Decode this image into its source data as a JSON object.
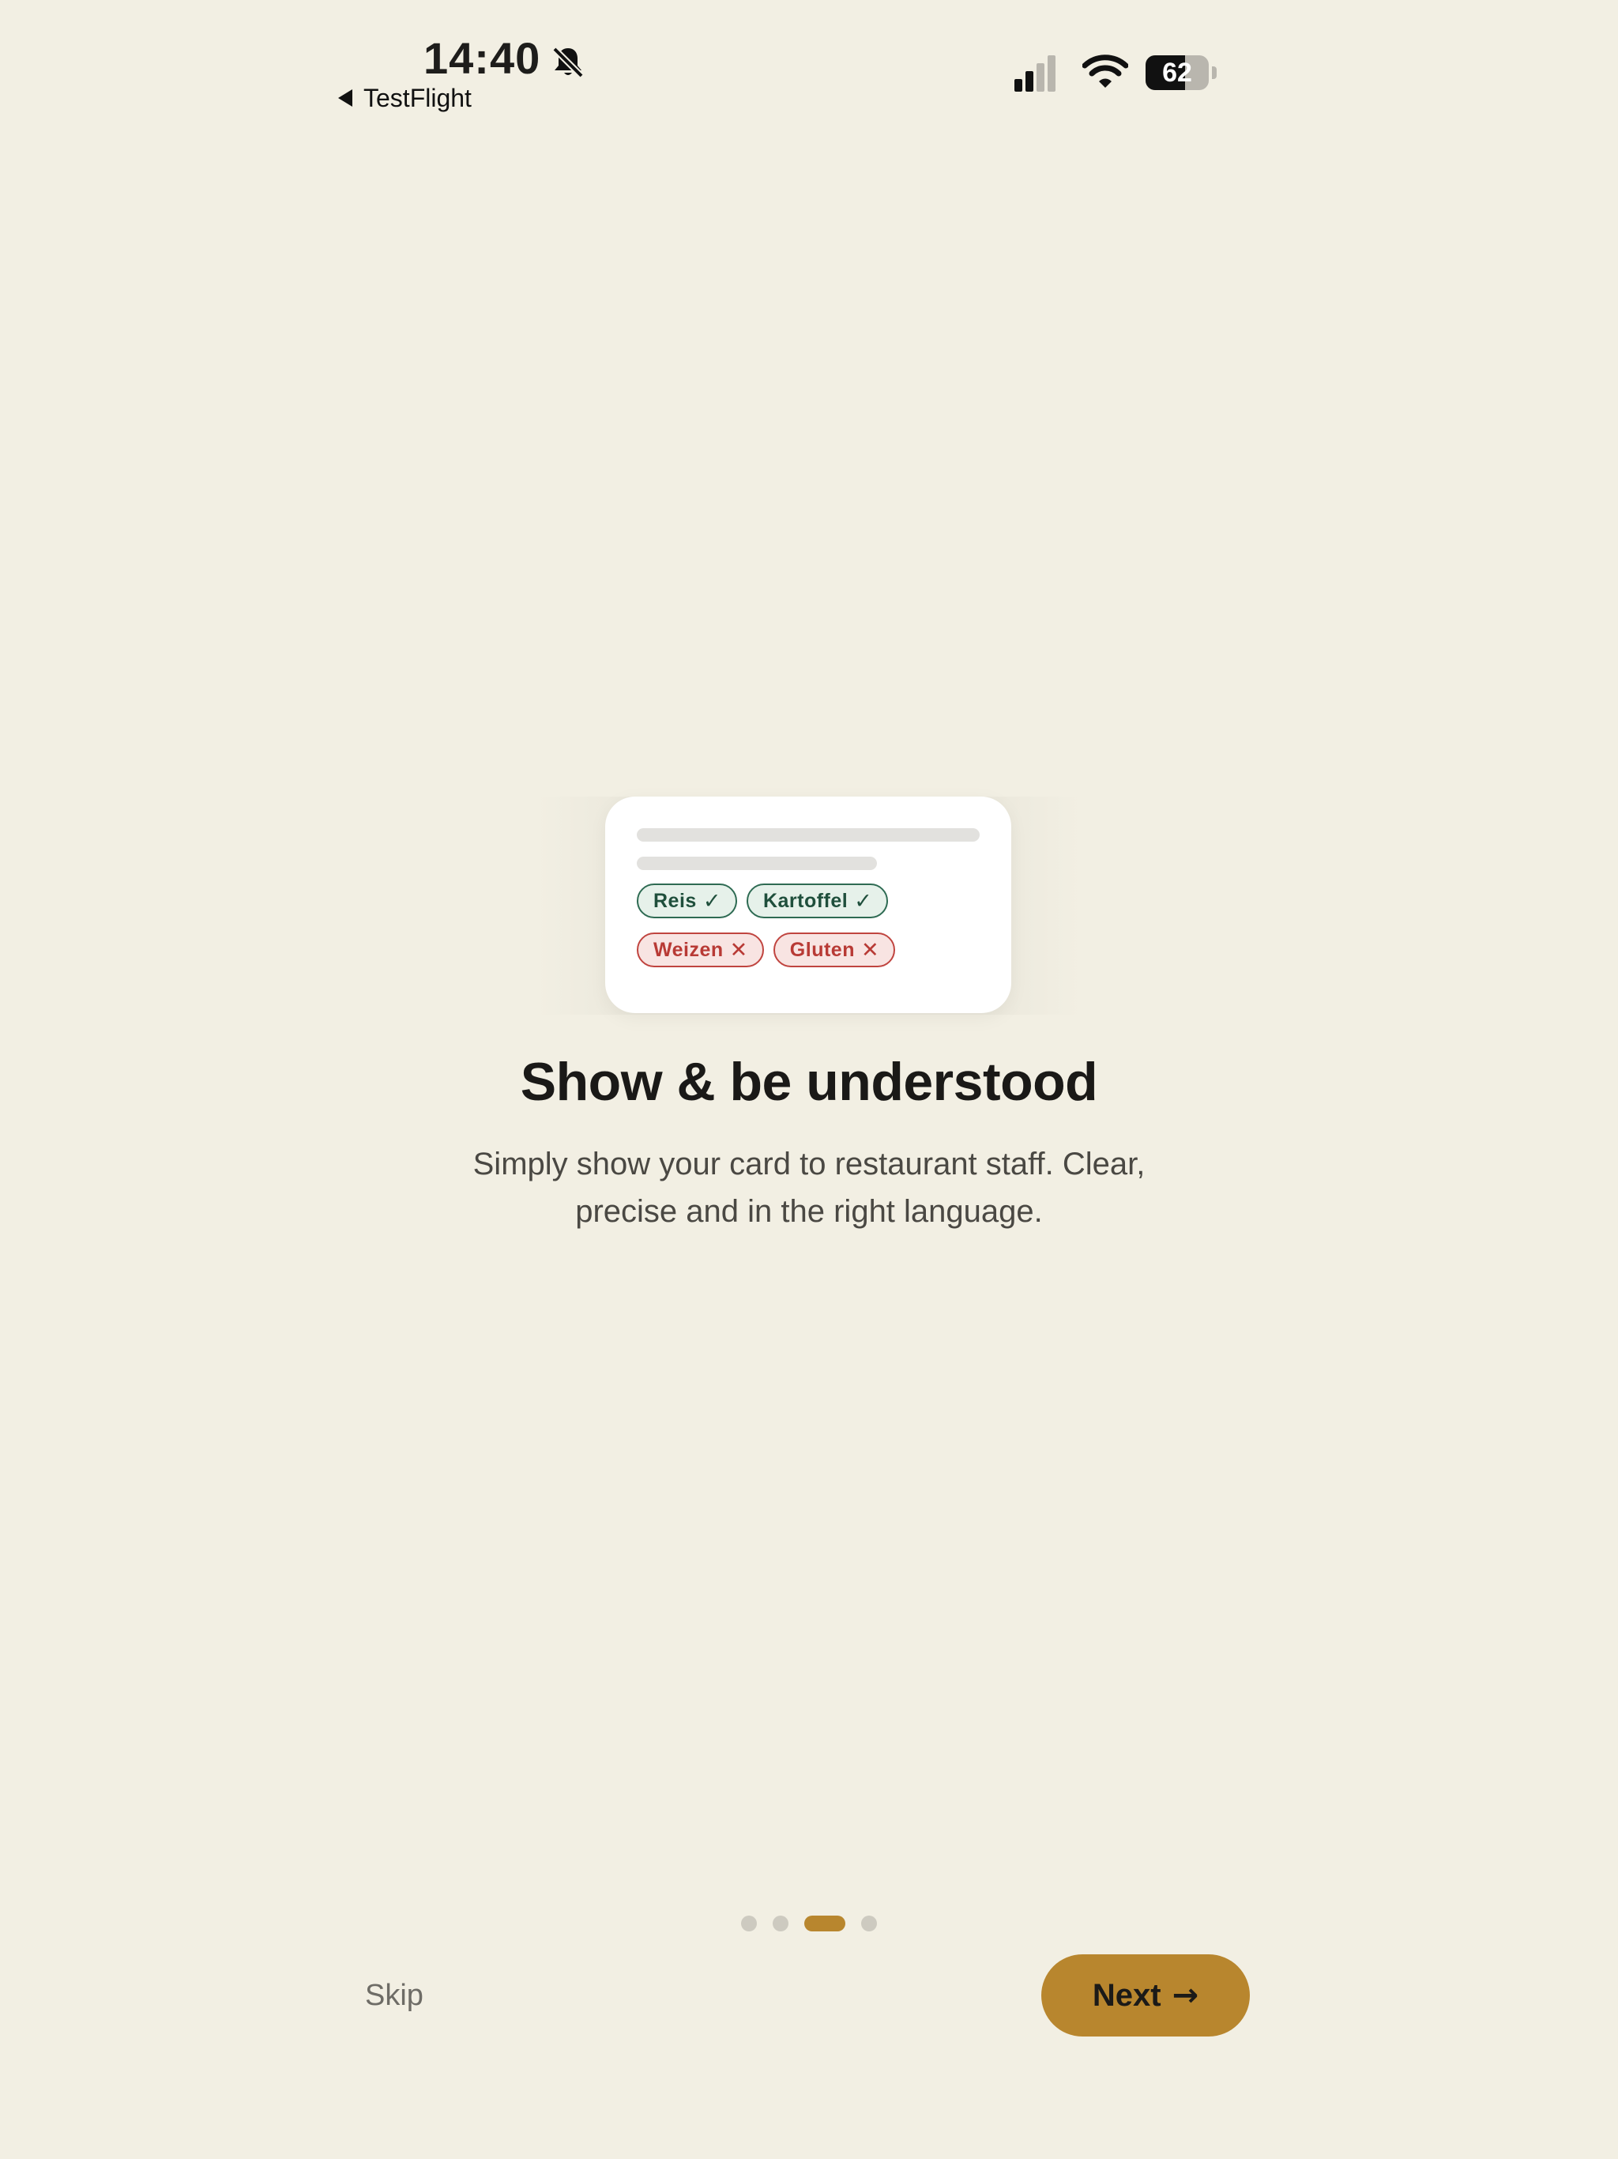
{
  "status_bar": {
    "time": "14:40",
    "back_app_label": "TestFlight",
    "battery_percent": "62",
    "icons": [
      "bell-slash-icon",
      "signal-icon",
      "wifi-icon",
      "battery-icon"
    ]
  },
  "illustration": {
    "safe_chips": [
      {
        "label": "Reis",
        "mark": "✓"
      },
      {
        "label": "Kartoffel",
        "mark": "✓"
      }
    ],
    "unsafe_chips": [
      {
        "label": "Weizen",
        "mark": "✕"
      },
      {
        "label": "Gluten",
        "mark": "✕"
      }
    ]
  },
  "onboarding": {
    "title": "Show & be understood",
    "subtitle": "Simply show your card to restaurant staff. Clear, precise and in the right language.",
    "page_count": 4,
    "active_page": 3
  },
  "actions": {
    "skip_label": "Skip",
    "next_label": "Next",
    "next_icon": "→"
  },
  "colors": {
    "background": "#f2efe3",
    "accent": "#b8862e",
    "safe": "#2e6b53",
    "unsafe": "#c0443f"
  }
}
